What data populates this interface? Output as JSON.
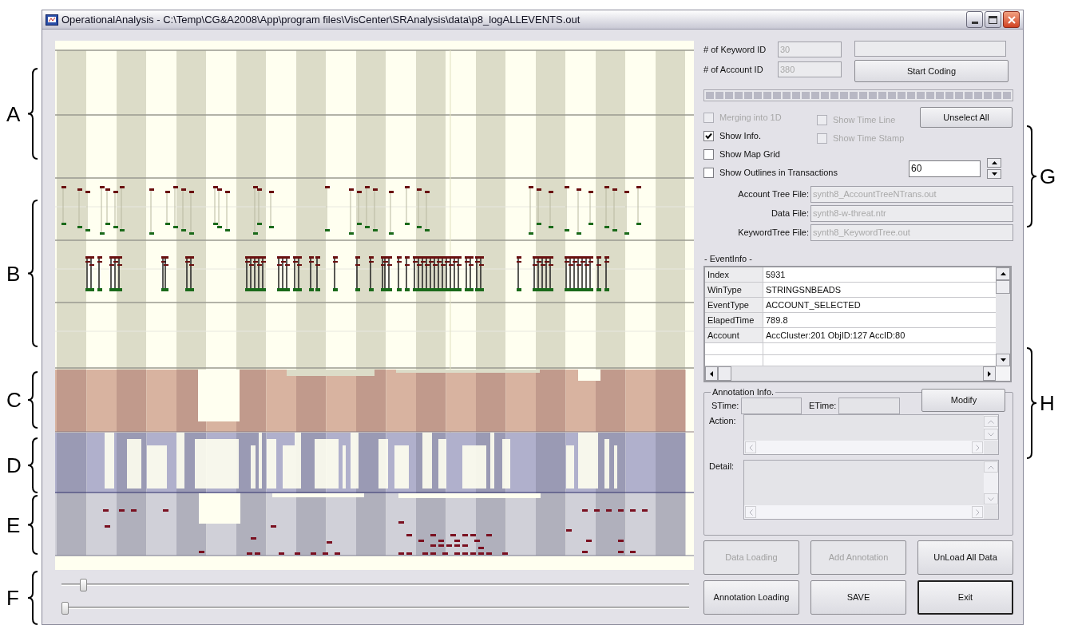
{
  "window": {
    "title": "OperationalAnalysis - C:\\Temp\\CG&A2008\\App\\program files\\VisCenter\\SRAnalysis\\data\\p8_logALLEVENTS.out"
  },
  "left_annotation_labels": [
    "A",
    "B",
    "C",
    "D",
    "E",
    "F"
  ],
  "right_annotation_labels": [
    "G",
    "H"
  ],
  "progress_bar": {
    "level": 1.0
  },
  "sliders": [
    {
      "level": 0.03
    },
    {
      "level": 0.0
    }
  ],
  "id_fields": [
    {
      "label": "# of Keyword ID",
      "value": "30",
      "disabled": true
    },
    {
      "label": "# of Account ID",
      "value": "380",
      "disabled": true
    }
  ],
  "start_coding_button": {
    "label": "Start Coding"
  },
  "checkboxes_column_1": [
    {
      "label": "Merging into 1D",
      "checked": false,
      "disabled": true
    },
    {
      "label": "Show Info.",
      "checked": true,
      "disabled": false
    },
    {
      "label": "Show Map Grid",
      "checked": false,
      "disabled": false
    },
    {
      "label": "Show Outlines in Transactions",
      "checked": false,
      "disabled": false
    }
  ],
  "checkboxes_column_2": [
    {
      "label": "Show Time Line",
      "checked": false,
      "disabled": true
    },
    {
      "label": "Show Time Stamp",
      "checked": false,
      "disabled": true
    }
  ],
  "unselect_all_button": {
    "label": "Unselect All"
  },
  "spinner": {
    "value": "60"
  },
  "file_fields": [
    {
      "label": "Account Tree File:",
      "value": "synth8_AccountTreeNTrans.out",
      "disabled": true
    },
    {
      "label": "Data File:",
      "value": "synth8-w-threat.ntr",
      "disabled": true
    },
    {
      "label": "KeywordTree File:",
      "value": "synth8_KeywordTree.out",
      "disabled": true
    }
  ],
  "event_info": {
    "title": "- EventInfo -",
    "rows": [
      {
        "name": "Index",
        "value": "5931"
      },
      {
        "name": "WinType",
        "value": "STRINGSNBEADS"
      },
      {
        "name": "EventType",
        "value": "ACCOUNT_SELECTED"
      },
      {
        "name": "ElapedTime",
        "value": "789.8"
      },
      {
        "name": "Account",
        "value": "AccCluster:201 ObjID:127 AccID:80"
      }
    ]
  },
  "annotation_info": {
    "title": "Annotation Info.",
    "stime_label": "STime:",
    "etime_label": "ETime:",
    "modify_button": "Modify",
    "action_label": "Action:",
    "detail_label": "Detail:"
  },
  "buttons": [
    {
      "label": "Data Loading",
      "disabled": true,
      "default": false
    },
    {
      "label": "Add Annotation",
      "disabled": true,
      "default": false
    },
    {
      "label": "UnLoad All Data",
      "disabled": false,
      "default": false
    },
    {
      "label": "Annotation Loading",
      "disabled": false,
      "default": false
    },
    {
      "label": "SAVE",
      "disabled": false,
      "default": false
    },
    {
      "label": "Exit",
      "disabled": false,
      "default": true
    }
  ]
}
